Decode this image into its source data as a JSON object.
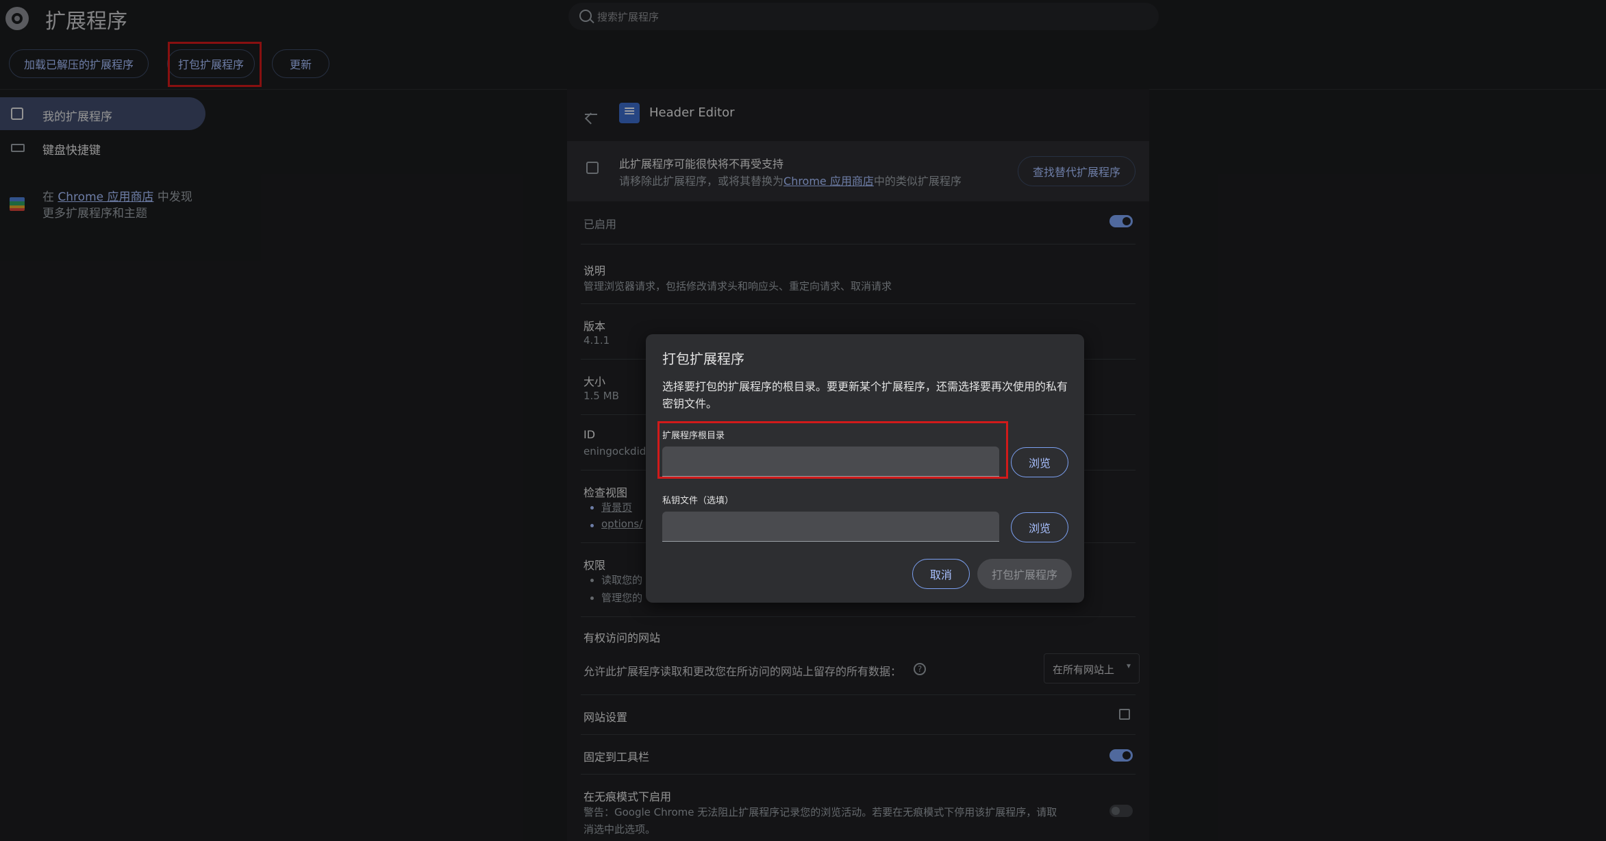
{
  "header": {
    "title": "扩展程序",
    "search_placeholder": "搜索扩展程序",
    "buttons": {
      "load_unpacked": "加载已解压的扩展程序",
      "pack": "打包扩展程序",
      "update": "更新"
    }
  },
  "sidebar": {
    "items": [
      {
        "label": "我的扩展程序"
      },
      {
        "label": "键盘快捷键"
      }
    ],
    "store_prefix": "在",
    "store_link": "Chrome 应用商店",
    "store_suffix": "中发现",
    "store_line2": "更多扩展程序和主题"
  },
  "detail": {
    "name": "Header Editor",
    "warning": {
      "title": "此扩展程序可能很快将不再受支持",
      "text_prefix": "请移除此扩展程序，或将其替换为",
      "text_link": "Chrome 应用商店",
      "text_suffix": "中的类似扩展程序",
      "button": "查找替代扩展程序"
    },
    "enabled_label": "已启用",
    "description_label": "说明",
    "description_text": "管理浏览器请求，包括修改请求头和响应头、重定向请求、取消请求",
    "version_label": "版本",
    "version_value": "4.1.1",
    "size_label": "大小",
    "size_value": "1.5 MB",
    "id_label": "ID",
    "id_value": "eningockdid",
    "inspect_label": "检查视图",
    "inspect_items": [
      "背景页",
      "options/"
    ],
    "permissions_label": "权限",
    "permissions_items": [
      "读取您的",
      "管理您的"
    ],
    "site_access_label": "有权访问的网站",
    "site_access_text": "允许此扩展程序读取和更改您在所访问的网站上留存的所有数据：",
    "site_access_select": "在所有网站上",
    "site_settings_label": "网站设置",
    "pin_label": "固定到工具栏",
    "incognito_label": "在无痕模式下启用",
    "incognito_warning_line1": "警告：Google Chrome 无法阻止扩展程序记录您的浏览活动。若要在无痕模式下停用该扩展程序，请取",
    "incognito_warning_line2": "消选中此选项。"
  },
  "dialog": {
    "title": "打包扩展程序",
    "description": "选择要打包的扩展程序的根目录。要更新某个扩展程序，还需选择要再次使用的私有密钥文件。",
    "root_label": "扩展程序根目录",
    "root_value": "",
    "key_label": "私钥文件（选填）",
    "key_value": "",
    "browse": "浏览",
    "cancel": "取消",
    "submit": "打包扩展程序"
  },
  "colors": {
    "accent": "#a8c0ff",
    "highlight": "#d11a1a",
    "nav_active": "#3f4b6b"
  }
}
